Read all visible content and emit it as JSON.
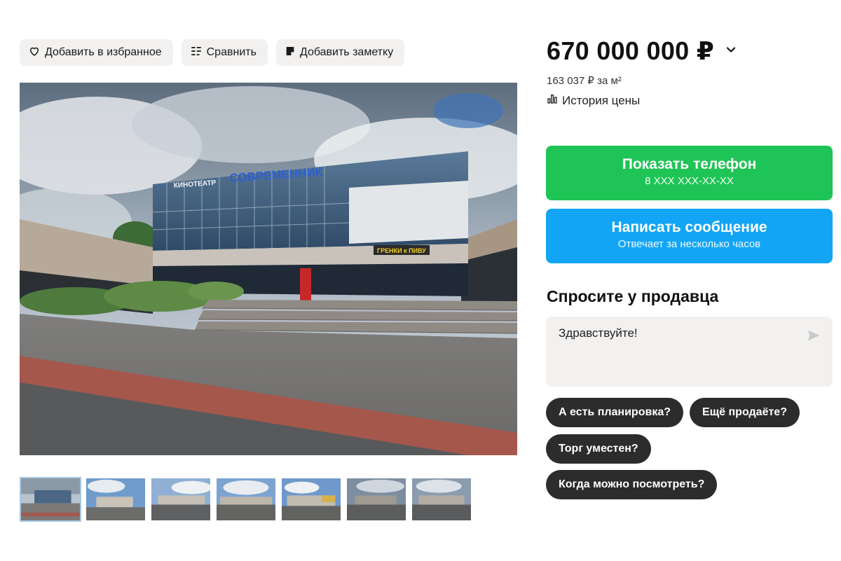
{
  "actions": {
    "favorite_label": "Добавить в избранное",
    "compare_label": "Сравнить",
    "note_label": "Добавить заметку"
  },
  "listing": {
    "price": "670 000 000 ₽",
    "price_per_m2": "163 037 ₽ за м²",
    "price_history_label": "История цены",
    "photo_count": 7,
    "active_photo": 1
  },
  "contact": {
    "phone_button": "Показать телефон",
    "phone_masked": "8 XXX XXX-XX-XX",
    "message_button": "Написать сообщение",
    "message_sub": "Отвечает за несколько часов"
  },
  "ask": {
    "title": "Спросите у продавца",
    "input_value": "Здравствуйте!",
    "chips": [
      "А есть планировка?",
      "Ещё продаёте?",
      "Торг уместен?",
      "Когда можно посмотреть?"
    ]
  },
  "photo_text": {
    "sign_small": "КИНОТЕАТР",
    "sign_main": "СОВРЕМЕННИК",
    "shop_sign": "ГРЕНКИ к ПИВУ"
  },
  "colors": {
    "green": "#1fc456",
    "blue": "#12a5f5",
    "chip": "#2c2c2c",
    "panel": "#f2f1f0"
  },
  "icons": {
    "favorite": "heart-icon",
    "compare": "compare-list-icon",
    "note": "note-icon",
    "price_toggle": "chevron-down-icon",
    "history": "bar-chart-icon",
    "send": "send-icon"
  }
}
